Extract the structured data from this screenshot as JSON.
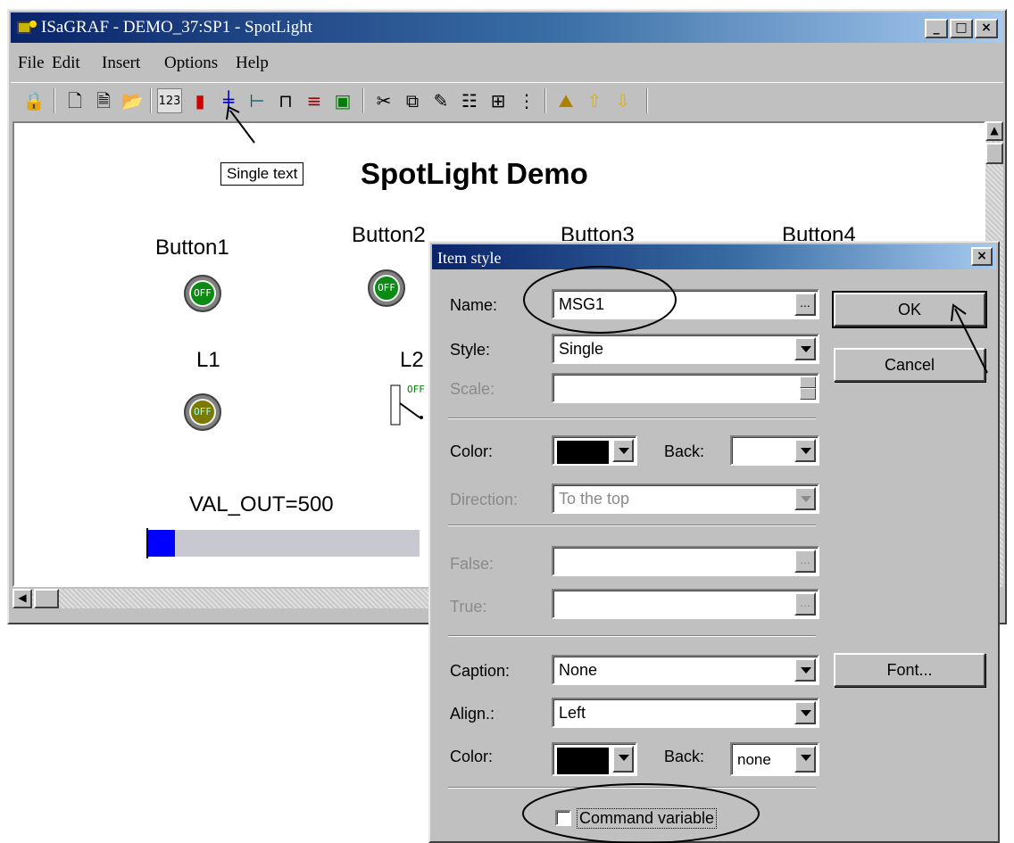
{
  "window": {
    "title": "ISaGRAF - DEMO_37:SP1 - SpotLight",
    "controls": [
      "_",
      "□",
      "×"
    ]
  },
  "menu": [
    "File",
    "Edit",
    "Insert",
    "Options",
    "Help"
  ],
  "toolbar": {
    "buttons": [
      {
        "icon": "lock-icon",
        "glyph": "🔒"
      },
      {
        "icon": "new-document-icon",
        "glyph": "🗋"
      },
      {
        "icon": "document-icon",
        "glyph": "🗎"
      },
      {
        "icon": "open-icon",
        "glyph": "📂"
      },
      {
        "icon": "single-text-icon",
        "glyph": "123"
      },
      {
        "icon": "bargraph-icon",
        "glyph": "▮"
      },
      {
        "icon": "slider-icon",
        "glyph": "╪"
      },
      {
        "icon": "trend-icon",
        "glyph": "⊢"
      },
      {
        "icon": "pulse-icon",
        "glyph": "⊓"
      },
      {
        "icon": "list-icon",
        "glyph": "≡"
      },
      {
        "icon": "picture-icon",
        "glyph": "▣"
      },
      {
        "icon": "cut-icon",
        "glyph": "✂"
      },
      {
        "icon": "copy-icon",
        "glyph": "⧉"
      },
      {
        "icon": "paint-icon",
        "glyph": "✎"
      },
      {
        "icon": "properties-icon",
        "glyph": "☷"
      },
      {
        "icon": "grid-icon",
        "glyph": "⊞"
      },
      {
        "icon": "align-icon",
        "glyph": "⋮"
      },
      {
        "icon": "image-icon",
        "glyph": "⛰"
      },
      {
        "icon": "up-arrow-icon",
        "glyph": "⇧"
      },
      {
        "icon": "down-arrow-icon",
        "glyph": "⇩"
      }
    ]
  },
  "canvas": {
    "tooltip": "Single text",
    "title": "SpotLight Demo",
    "buttons": [
      {
        "label": "Button1",
        "state": "OFF"
      },
      {
        "label": "Button2",
        "state": "OFF"
      },
      {
        "label": "Button3"
      },
      {
        "label": "Button4"
      }
    ],
    "lamps": [
      {
        "label": "L1",
        "state": "OFF"
      },
      {
        "label": "L2",
        "state": "OFF"
      }
    ],
    "value_label": "VAL_OUT=500",
    "value_bar_fraction": 0.1
  },
  "dialog": {
    "title": "Item style",
    "name_label": "Name:",
    "name_value": "MSG1",
    "style_label": "Style:",
    "style_value": "Single",
    "scale_label": "Scale:",
    "scale_value": "",
    "color_label": "Color:",
    "color_value": "#000000",
    "back_label": "Back:",
    "back_value": "",
    "direction_label": "Direction:",
    "direction_value": "To the top",
    "false_label": "False:",
    "false_value": "",
    "true_label": "True:",
    "true_value": "",
    "caption_label": "Caption:",
    "caption_value": "None",
    "align_label": "Align.:",
    "align_value": "Left",
    "color2_label": "Color:",
    "color2_value": "#000000",
    "back2_label": "Back:",
    "back2_value": "none",
    "command_variable_label": "Command variable",
    "command_variable_checked": false,
    "ok_label": "OK",
    "cancel_label": "Cancel",
    "font_label": "Font...",
    "ellipsis": "...",
    "close_glyph": "×"
  }
}
